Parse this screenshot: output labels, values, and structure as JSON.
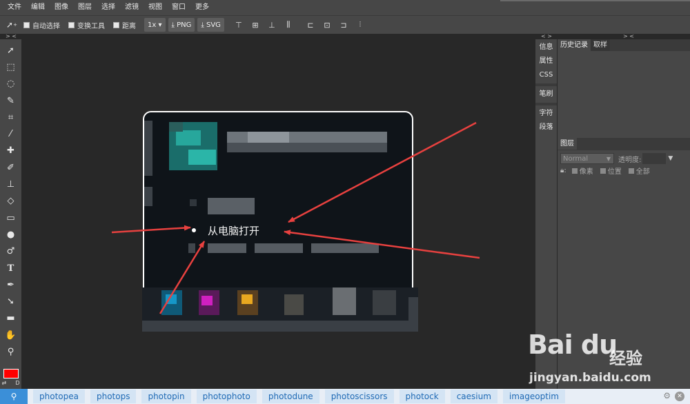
{
  "menu": {
    "items": [
      "文件",
      "编辑",
      "图像",
      "图层",
      "选择",
      "滤镜",
      "视图",
      "窗口",
      "更多"
    ]
  },
  "options": {
    "auto_select": "自动选择",
    "transform_tools": "变换工具",
    "distance": "距离",
    "zoom": "1x",
    "png_label": "PNG",
    "svg_label": "SVG"
  },
  "canvas": {
    "label": "从电脑打开"
  },
  "side_tabs": {
    "info": "信息",
    "properties": "属性",
    "css": "CSS",
    "brush": "笔刷",
    "character": "字符",
    "paragraph": "段落"
  },
  "right_panel": {
    "history_tab": "历史记录",
    "swatch_tab": "取样",
    "layers_tab": "图层",
    "blend_mode": "Normal",
    "opacity_label": "透明度:",
    "lock_pixels": "像素",
    "lock_position": "位置",
    "lock_all": "全部"
  },
  "toolbar": {
    "color_swap": "⇄",
    "color_default": "D"
  },
  "bookmarks": {
    "items": [
      "photopea",
      "photops",
      "photopin",
      "photophoto",
      "photodune",
      "photoscissors",
      "photock",
      "caesium",
      "imageoptim"
    ]
  },
  "watermark": {
    "logo": "Bai du",
    "cn": "经验",
    "url": "jingyan.baidu.com"
  },
  "colors": {
    "foreground": "#ff0000",
    "arrow": "#e8413f",
    "bookmark_accent": "#3b8fd8"
  }
}
